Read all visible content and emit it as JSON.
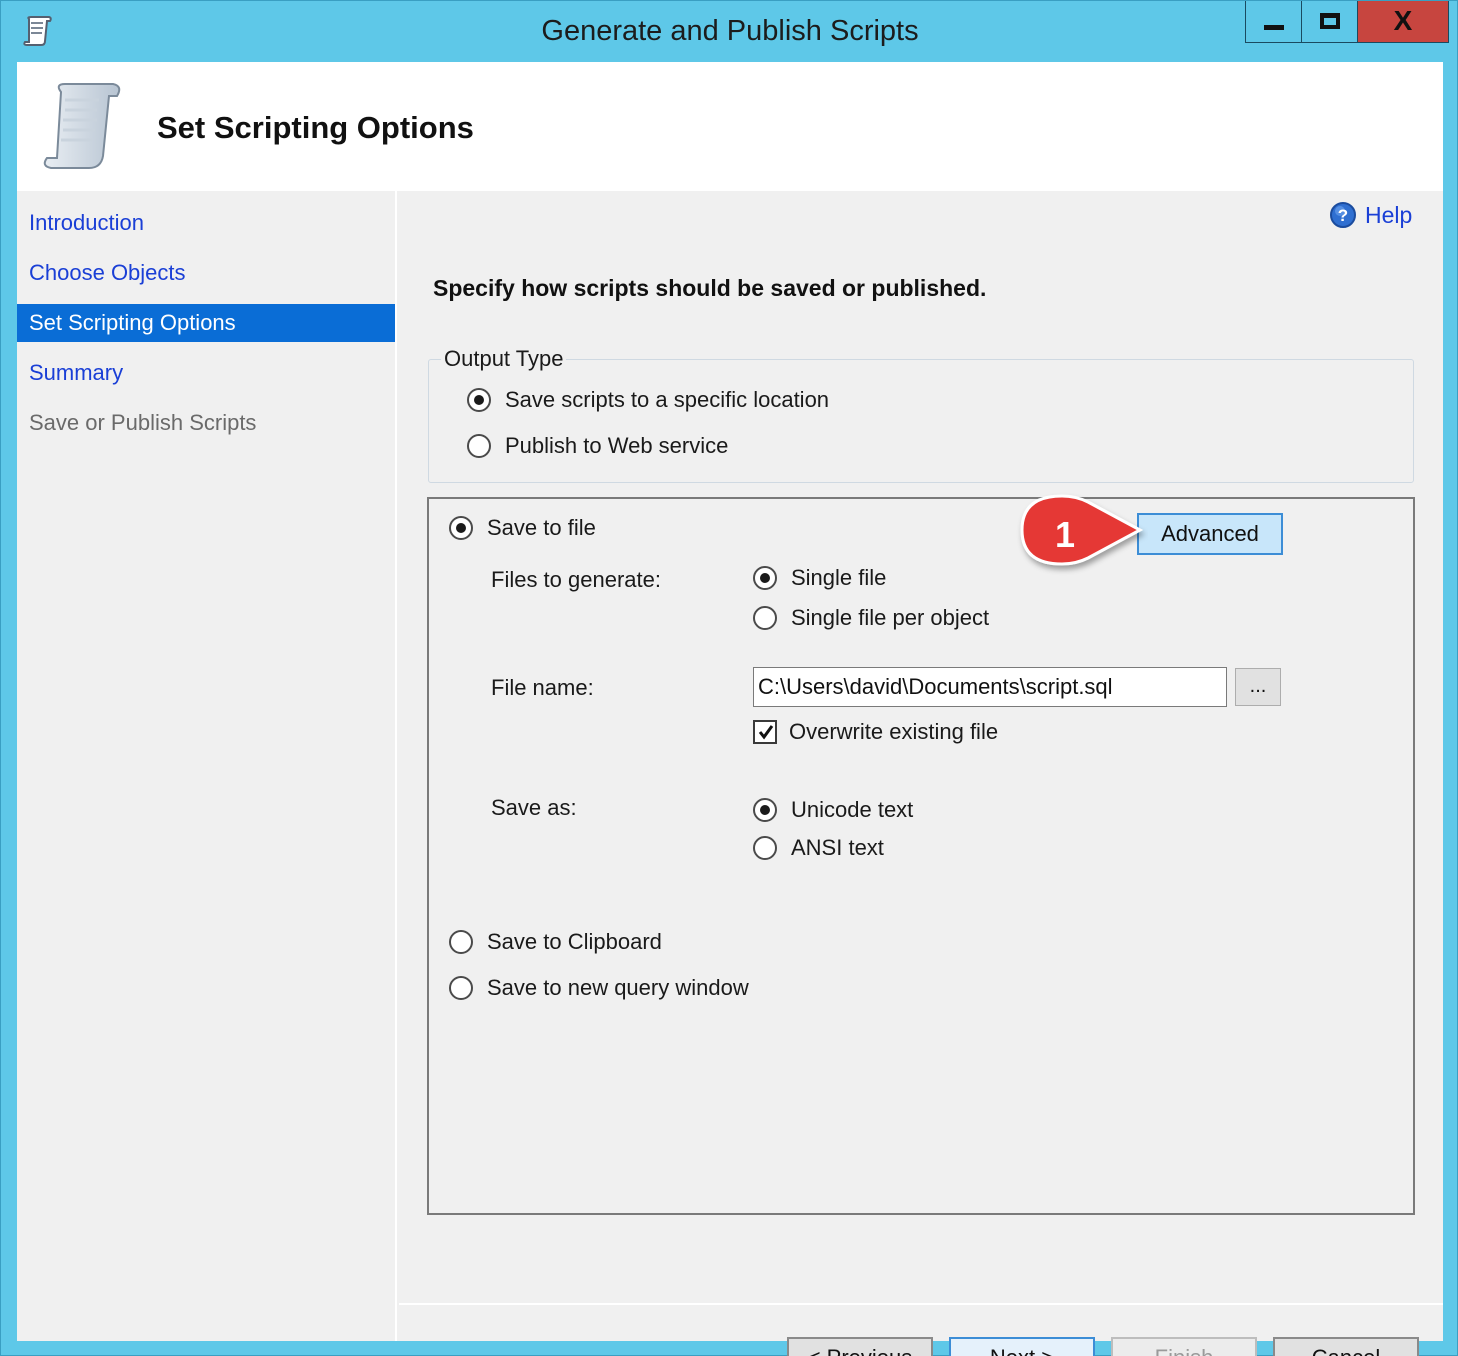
{
  "window": {
    "title": "Generate and Publish Scripts",
    "close_glyph": "X"
  },
  "header": {
    "title": "Set Scripting Options"
  },
  "sidebar": {
    "items": [
      {
        "label": "Introduction",
        "state": "link"
      },
      {
        "label": "Choose Objects",
        "state": "link"
      },
      {
        "label": "Set Scripting Options",
        "state": "active"
      },
      {
        "label": "Summary",
        "state": "link"
      },
      {
        "label": "Save or Publish Scripts",
        "state": "disabled"
      }
    ]
  },
  "main": {
    "help_label": "Help",
    "instruction": "Specify how scripts should be saved or published.",
    "output_type": {
      "legend": "Output Type",
      "options": [
        {
          "label": "Save scripts to a specific location",
          "checked": true
        },
        {
          "label": "Publish to Web service",
          "checked": false
        }
      ]
    },
    "save_to_file": {
      "label": "Save to file",
      "checked": true,
      "advanced_label": "Advanced",
      "files_to_generate_label": "Files to generate:",
      "files_options": [
        {
          "label": "Single file",
          "checked": true
        },
        {
          "label": "Single file per object",
          "checked": false
        }
      ],
      "file_name_label": "File name:",
      "file_name_value": "C:\\Users\\david\\Documents\\script.sql",
      "browse_label": "...",
      "overwrite_label": "Overwrite existing file",
      "overwrite_checked": true,
      "save_as_label": "Save as:",
      "save_as_options": [
        {
          "label": "Unicode text",
          "checked": true
        },
        {
          "label": "ANSI text",
          "checked": false
        }
      ]
    },
    "other_destinations": [
      {
        "label": "Save to Clipboard",
        "checked": false
      },
      {
        "label": "Save to new query window",
        "checked": false
      }
    ]
  },
  "footer": {
    "previous_label": "< Previous",
    "next_label": "Next >",
    "finish_label": "Finish",
    "cancel_label": "Cancel"
  },
  "annotation": {
    "number": "1",
    "color": "#e53935"
  },
  "colors": {
    "window_frame": "#5ec8e8",
    "selected_nav": "#0a6dd6",
    "link": "#1a3fd6",
    "close_button": "#c7453f"
  }
}
